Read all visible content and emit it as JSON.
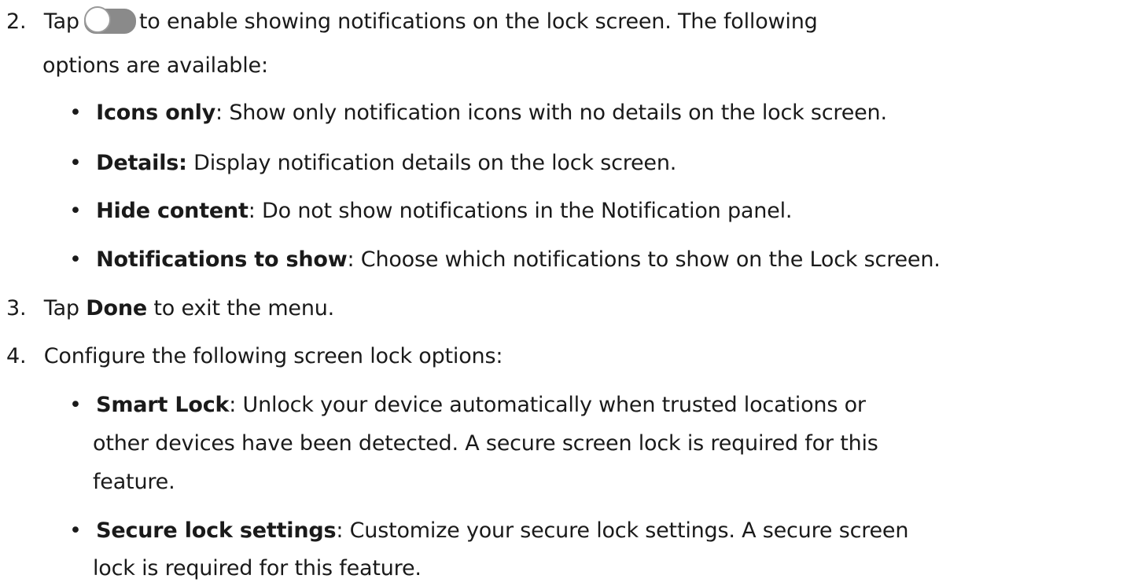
{
  "steps": [
    {
      "number": "2.",
      "text_before_toggle": "Tap",
      "toggle_icon": "toggle-switch-icon",
      "text_after_toggle": "to enable showing notifications on the lock screen. The following",
      "text_line2": "options are available:",
      "bullets": [
        {
          "term": "Icons only",
          "desc": ": Show only notification icons with no details on the lock screen."
        },
        {
          "term": "Details:",
          "desc": " Display notification details on the lock screen."
        },
        {
          "term": "Hide content",
          "desc": ": Do not show notifications in the Notification panel."
        },
        {
          "term": "Notifications to show",
          "desc": ": Choose which notifications to show on the Lock screen."
        }
      ]
    },
    {
      "number": "3.",
      "text_before": "Tap ",
      "term": "Done",
      "text_after": " to exit the menu."
    },
    {
      "number": "4.",
      "text": "Configure the following screen lock options:",
      "bullets": [
        {
          "term": "Smart Lock",
          "desc_line1": ": Unlock your device automatically when trusted locations or",
          "desc_line2": "other devices have been detected. A secure screen lock is required for this",
          "desc_line3": "feature."
        },
        {
          "term": "Secure lock settings",
          "desc_line1": ": Customize your secure lock settings. A secure screen",
          "desc_line2": "lock is required for this feature."
        }
      ]
    }
  ],
  "bullet_glyph": "•",
  "colors": {
    "text": "#1a1a1a",
    "toggle_track": "#8a8a8a",
    "toggle_knob": "#ffffff"
  }
}
